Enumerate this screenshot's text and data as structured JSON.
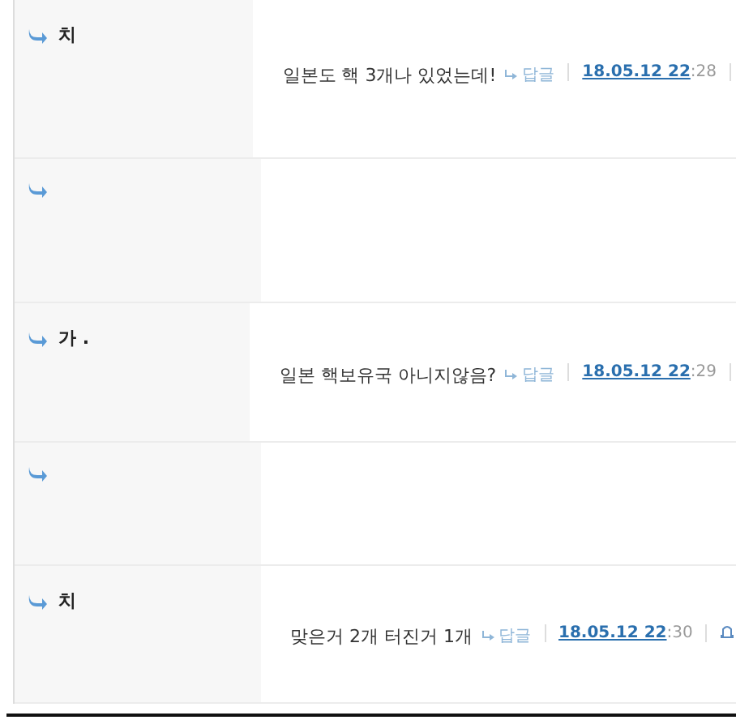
{
  "comments": [
    {
      "kind": "comment",
      "nick": "치",
      "message": "일본도 핵 3개나 있었는데!",
      "reply": "답글",
      "date_link": "18.05.12 22",
      "time_rest": ":28",
      "bell": false
    },
    {
      "kind": "hidden"
    },
    {
      "kind": "comment",
      "nick": "가 .",
      "message": "일본 핵보유국 아니지않음?",
      "reply": "답글",
      "date_link": "18.05.12 22",
      "time_rest": ":29",
      "bell": false
    },
    {
      "kind": "hidden"
    },
    {
      "kind": "comment",
      "nick": "치",
      "message": "맞은거 2개 터진거 1개",
      "reply": "답글",
      "date_link": "18.05.12 22",
      "time_rest": ":30",
      "bell": true
    }
  ]
}
